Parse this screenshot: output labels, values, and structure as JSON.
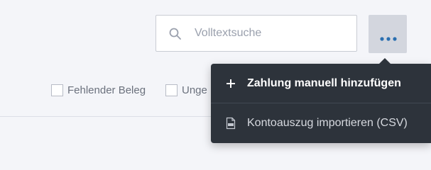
{
  "search": {
    "placeholder": "Volltextsuche",
    "value": ""
  },
  "more_button": {
    "icon": "more-horizontal-icon",
    "dot_color": "#2a6fb0"
  },
  "filters": [
    {
      "label": "Fehlender Beleg",
      "checked": false
    },
    {
      "label": "Unge",
      "checked": false
    }
  ],
  "dropdown_menu": {
    "items": [
      {
        "label": "Zahlung manuell hinzufügen",
        "icon": "plus-icon"
      },
      {
        "label": "Kontoauszug importieren (CSV)",
        "icon": "csv-file-icon"
      }
    ]
  },
  "colors": {
    "page_background": "#f4f5f9",
    "menu_background": "#2d333b",
    "button_background": "#d3d6de",
    "accent": "#2a6fb0"
  }
}
